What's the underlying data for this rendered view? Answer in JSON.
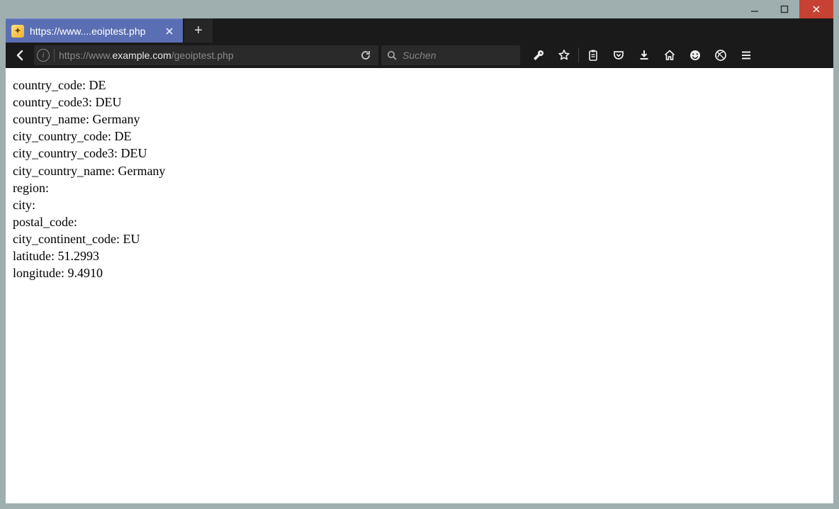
{
  "window": {
    "tab_title": "https://www....eoiptest.php",
    "url_pre": "https://www.",
    "url_domain": "example.com",
    "url_post": "/geoiptest.php",
    "search_placeholder": "Suchen"
  },
  "page": {
    "lines": [
      "country_code: DE",
      "country_code3: DEU",
      "country_name: Germany",
      "city_country_code: DE",
      "city_country_code3: DEU",
      "city_country_name: Germany",
      "region:",
      "city:",
      "postal_code:",
      "city_continent_code: EU",
      "latitude: 51.2993",
      "longitude: 9.4910"
    ]
  }
}
